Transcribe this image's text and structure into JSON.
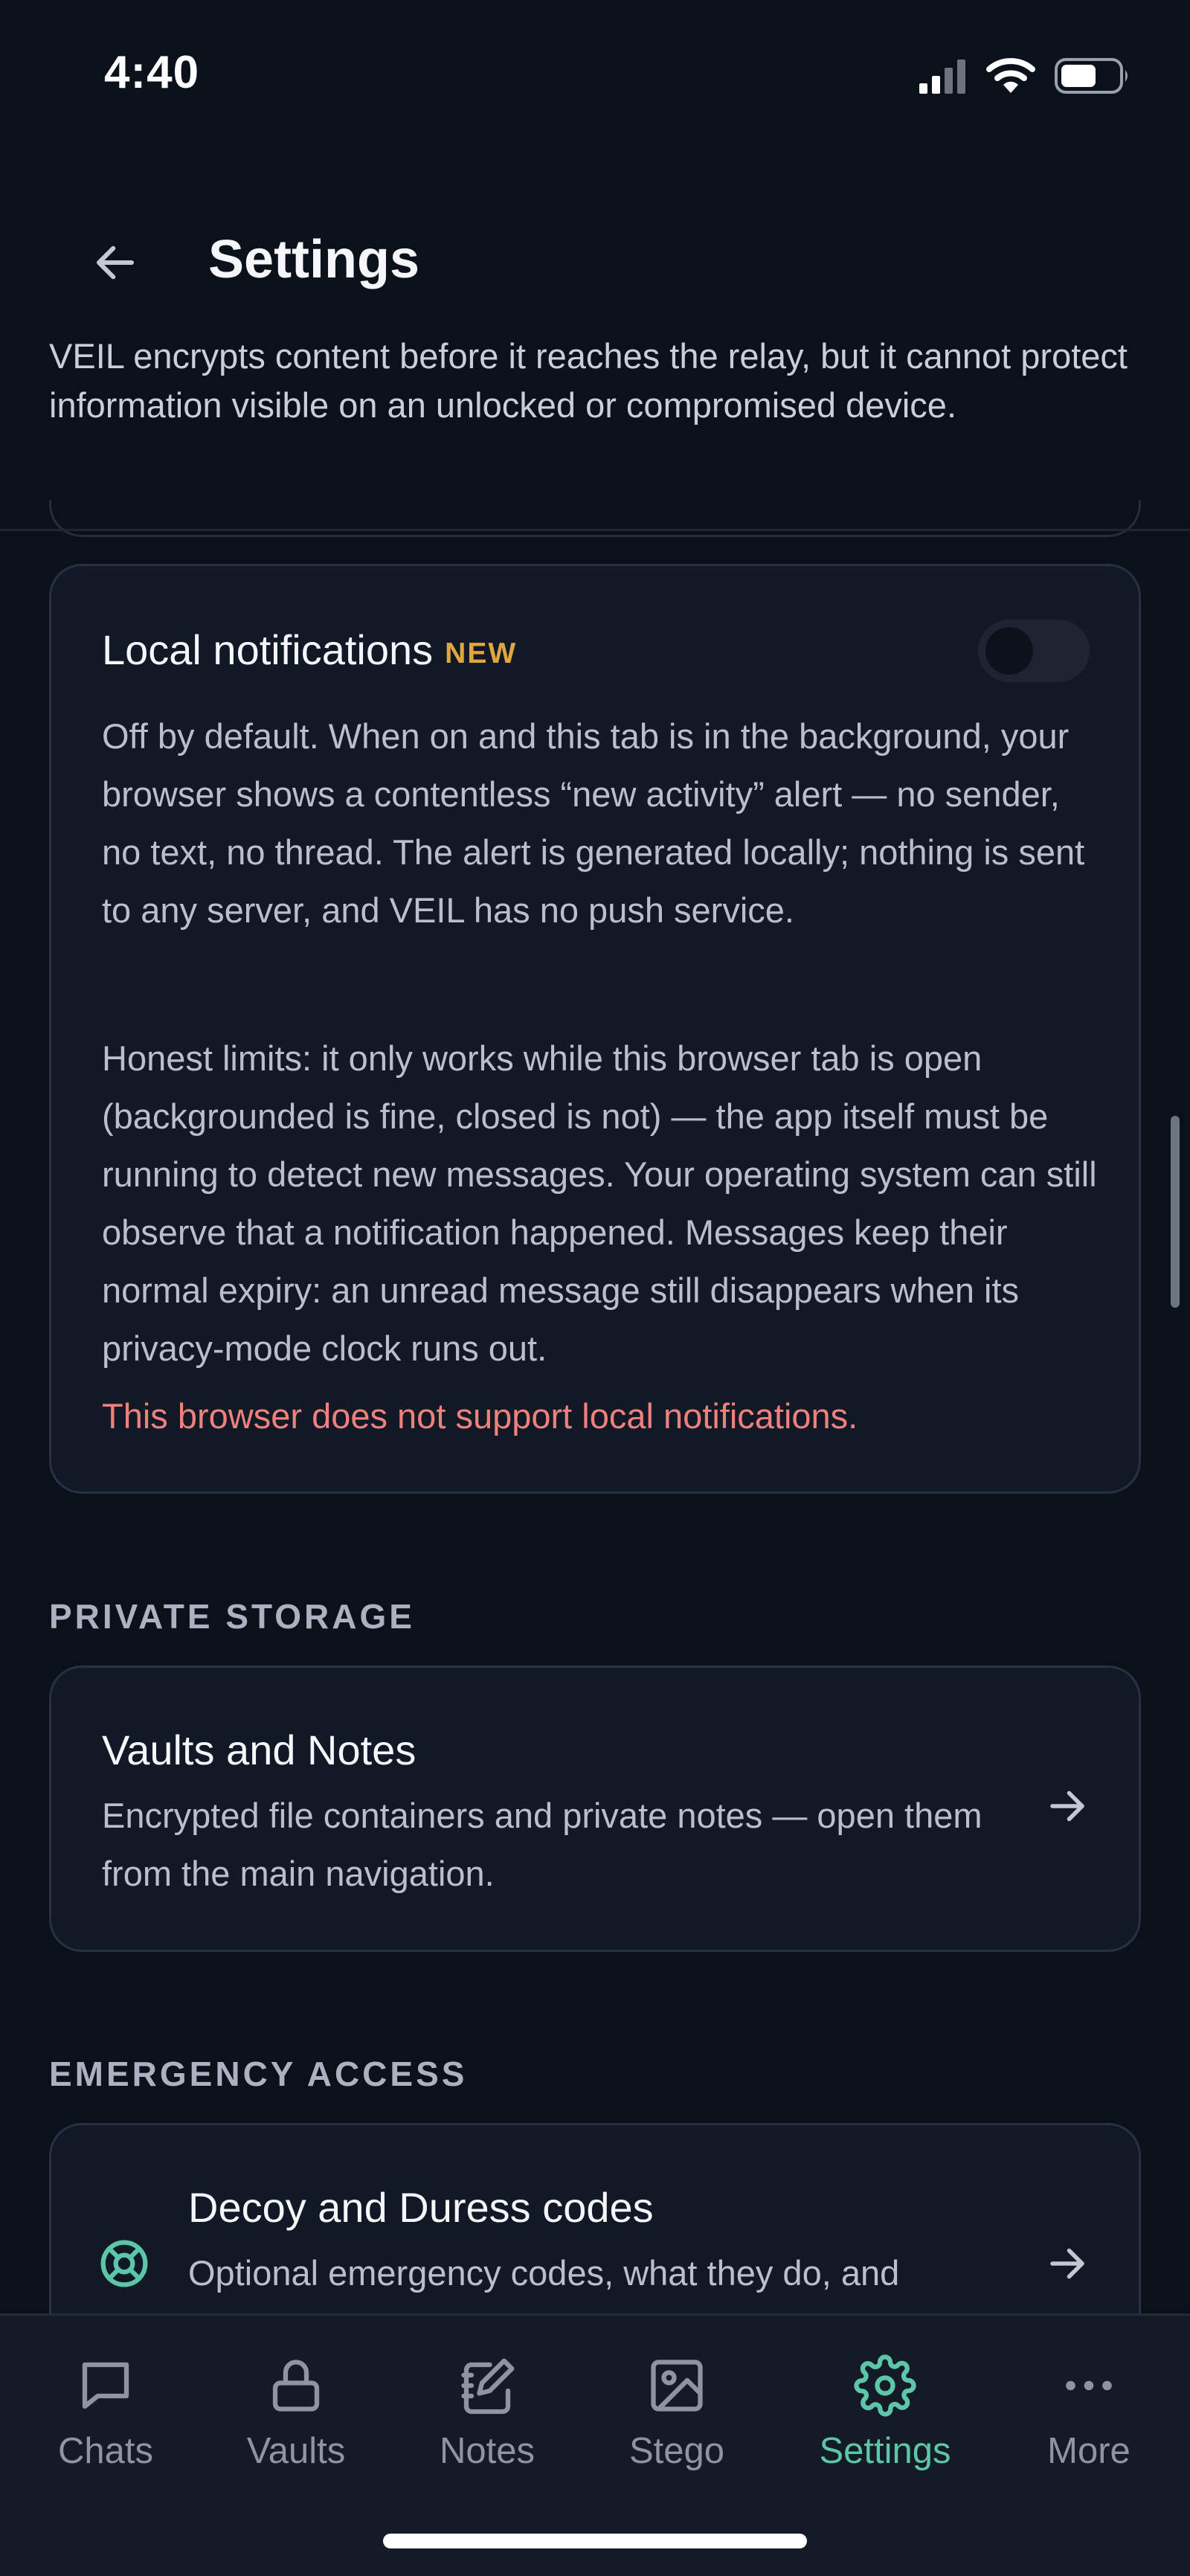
{
  "status_bar": {
    "time": "4:40"
  },
  "header": {
    "title": "Settings",
    "back_icon": "arrow-left-icon"
  },
  "intro_text": "VEIL encrypts content before it reaches the relay, but it cannot protect information visible on an unlocked or compromised device.",
  "notifications_card": {
    "title": "Local notifications",
    "badge": "NEW",
    "toggle_on": false,
    "paragraph_1": "Off by default. When on and this tab is in the background, your browser shows a contentless “new activity” alert — no sender, no text, no thread. The alert is generated locally; nothing is sent to any server, and VEIL has no push service.",
    "paragraph_2": "Honest limits: it only works while this browser tab is open (backgrounded is fine, closed is not) — the app itself must be running to detect new messages. Your operating system can still observe that a notification happened. Messages keep their normal expiry: an unread message still disappears when its privacy-mode clock runs out.",
    "error": "This browser does not support local notifications."
  },
  "private_storage": {
    "section_label": "PRIVATE STORAGE",
    "title": "Vaults and Notes",
    "description": "Encrypted file containers and private notes — open them from the main navigation."
  },
  "emergency_access": {
    "section_label": "EMERGENCY ACCESS",
    "title": "Decoy and Duress codes",
    "description": "Optional emergency codes, what they do, and"
  },
  "bottom_nav": {
    "items": [
      {
        "label": "Chats",
        "icon": "chat-bubble-icon"
      },
      {
        "label": "Vaults",
        "icon": "lock-icon"
      },
      {
        "label": "Notes",
        "icon": "notebook-icon"
      },
      {
        "label": "Stego",
        "icon": "image-icon"
      },
      {
        "label": "Settings",
        "icon": "gear-icon"
      },
      {
        "label": "More",
        "icon": "more-dots-icon"
      }
    ],
    "active": "Settings"
  },
  "colors": {
    "background": "#0b111b",
    "card": "#111826",
    "accent": "#5cc7a8",
    "badge": "#e2a640",
    "error": "#f0807c"
  }
}
